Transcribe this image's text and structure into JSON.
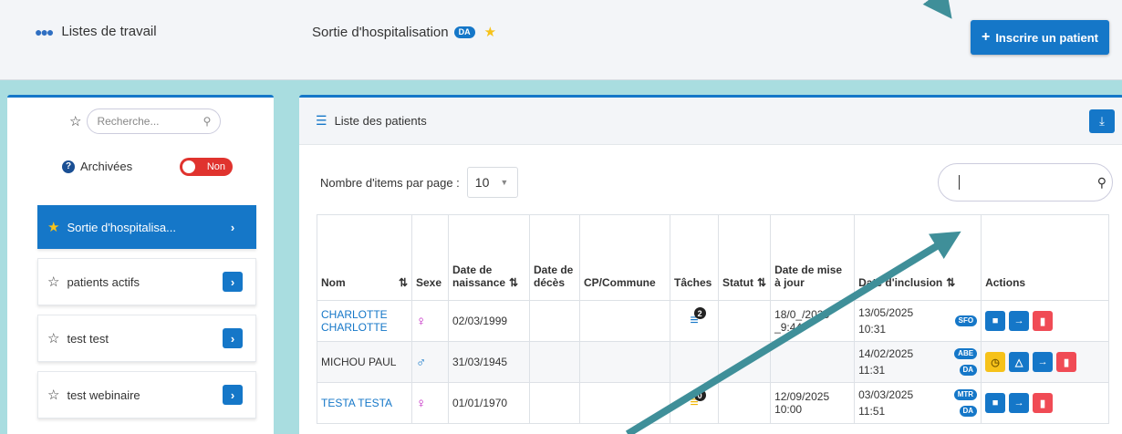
{
  "header": {
    "worklists_label": "Listes de travail",
    "page_title": "Sortie d'hospitalisation",
    "page_badge": "DA",
    "register_button": "Inscrire un patient"
  },
  "sidebar": {
    "search_placeholder": "Recherche...",
    "archived_label": "Archivées",
    "archived_toggle": "Non",
    "items": [
      {
        "label": "Sortie d'hospitalisa...",
        "active": true
      },
      {
        "label": "patients actifs",
        "active": false
      },
      {
        "label": "test test",
        "active": false
      },
      {
        "label": "test webinaire",
        "active": false
      }
    ]
  },
  "main": {
    "panel_title": "Liste des patients",
    "per_page_label": "Nombre d'items par page :",
    "per_page_value": "10",
    "search_value": "",
    "columns": [
      "Nom",
      "Sexe",
      "Date de naissance",
      "Date de décès",
      "CP/Commune",
      "Tâches",
      "Statut",
      "Date de mise à jour",
      "Date d'inclusion",
      "Actions"
    ],
    "rows": [
      {
        "name": "CHARLOTTE CHARLOTTE",
        "sex": "F",
        "birth": "02/03/1999",
        "death": "",
        "commune": "",
        "tasks": "2",
        "status": "",
        "updated": "18/0_/2025 _9:44",
        "inclusion_date": "13/05/2025",
        "inclusion_time": "10:31",
        "tags": [
          "SFO"
        ]
      },
      {
        "name": "MICHOU PAUL",
        "sex": "M",
        "birth": "31/03/1945",
        "death": "",
        "commune": "",
        "tasks": "",
        "status": "",
        "updated": "",
        "inclusion_date": "14/02/2025",
        "inclusion_time": "11:31",
        "tags": [
          "ABE",
          "DA"
        ]
      },
      {
        "name": "TESTA TESTA",
        "sex": "F",
        "birth": "01/01/1970",
        "death": "",
        "commune": "",
        "tasks": "0",
        "status": "",
        "updated": "12/09/2025 10:00",
        "inclusion_date": "03/03/2025",
        "inclusion_time": "11:51",
        "tags": [
          "MTR",
          "DA"
        ]
      }
    ]
  },
  "colors": {
    "primary": "#1577c8",
    "danger": "#f04b55",
    "warning": "#f6c21a",
    "arrow": "#3f8f99",
    "page_bg": "#a9dde0"
  }
}
